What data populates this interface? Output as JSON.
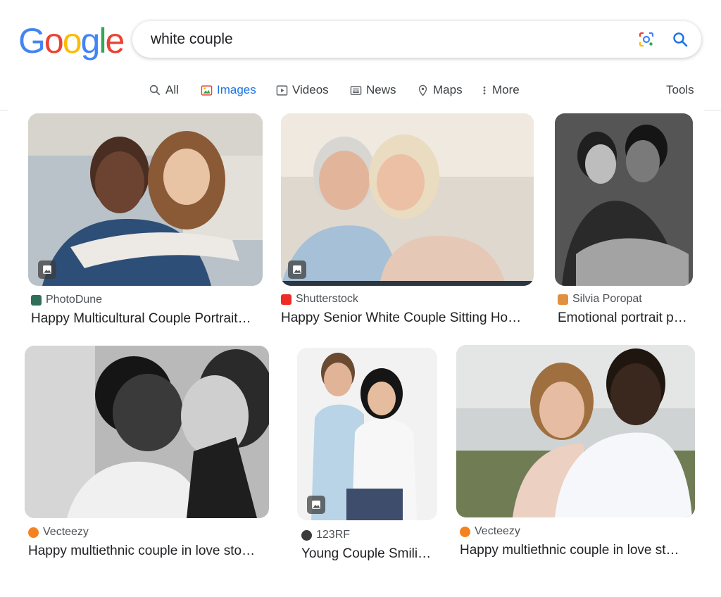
{
  "logo": {
    "letters": [
      "G",
      "o",
      "o",
      "g",
      "l",
      "e"
    ],
    "colors": [
      "#4285F4",
      "#EA4335",
      "#FBBC05",
      "#4285F4",
      "#34A853",
      "#EA4335"
    ]
  },
  "search": {
    "query": "white couple",
    "lens_icon": "google-lens-icon",
    "search_icon": "magnifier-icon"
  },
  "tabs": [
    {
      "label": "All",
      "icon": "search-icon",
      "active": false
    },
    {
      "label": "Images",
      "icon": "image-icon",
      "active": true
    },
    {
      "label": "Videos",
      "icon": "play-icon",
      "active": false
    },
    {
      "label": "News",
      "icon": "newspaper-icon",
      "active": false
    },
    {
      "label": "Maps",
      "icon": "map-pin-icon",
      "active": false
    },
    {
      "label": "More",
      "icon": "more-vertical-icon",
      "active": false
    }
  ],
  "tools_label": "Tools",
  "accent": "#1a73e8",
  "results": [
    {
      "source": "PhotoDune",
      "title": "Happy Multicultural Couple Portrait…",
      "favicon_color": "#2f6f5a"
    },
    {
      "source": "Shutterstock",
      "title": "Happy Senior White Couple Sitting Ho…",
      "favicon_color": "#ee2b24"
    },
    {
      "source": "Silvia Poropat",
      "title": "Emotional portrait p…",
      "favicon_color": "#e09040"
    },
    {
      "source": "Vecteezy",
      "title": "Happy multiethnic couple in love sto…",
      "favicon_color": "#f58220"
    },
    {
      "source": "123RF",
      "title": "Young Couple Smili…",
      "favicon_color": "#3b3b3b"
    },
    {
      "source": "Vecteezy",
      "title": "Happy multiethnic couple in love st…",
      "favicon_color": "#f58220"
    }
  ]
}
